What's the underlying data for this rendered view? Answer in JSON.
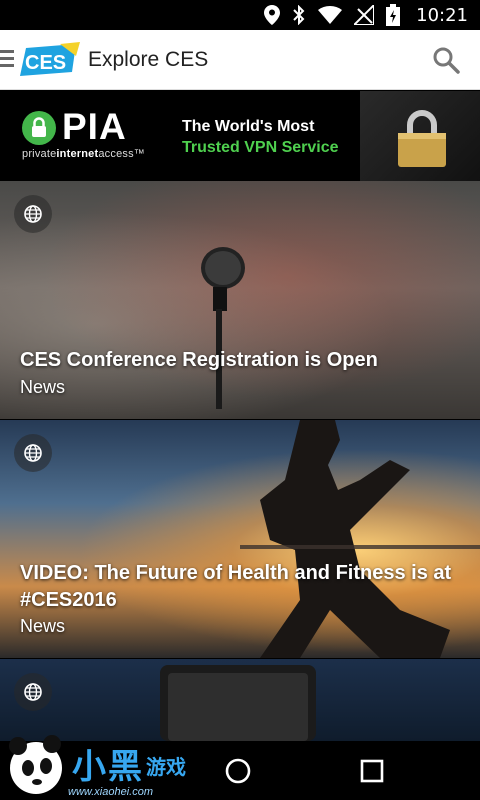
{
  "status_bar": {
    "time": "10:21",
    "icons": [
      "location-icon",
      "bluetooth-icon",
      "wifi-icon",
      "no-signal-icon",
      "battery-charging-icon"
    ]
  },
  "app_bar": {
    "title": "Explore CES",
    "logo_text": "CES",
    "menu_icon": "menu-icon",
    "search_icon": "search-icon"
  },
  "ad": {
    "brand": "PIA",
    "tagline_pre": "private",
    "tagline_bold": "internet",
    "tagline_post": "access",
    "tagline_tm": "™",
    "headline_line1": "The World's Most",
    "headline_line2": "Trusted VPN Service",
    "accent_color": "#4fd04f"
  },
  "feed": [
    {
      "title": "CES Conference Registration is Open",
      "category": "News",
      "icon": "globe-icon"
    },
    {
      "title": "VIDEO: The Future of Health and Fitness is at #CES2016",
      "category": "News",
      "icon": "globe-icon"
    },
    {
      "title": "",
      "category": "",
      "icon": "globe-icon"
    }
  ],
  "nav_bar": {
    "buttons": [
      "back-icon",
      "home-icon",
      "recents-icon"
    ]
  },
  "watermark": {
    "text": "www.xiaohei.com"
  }
}
